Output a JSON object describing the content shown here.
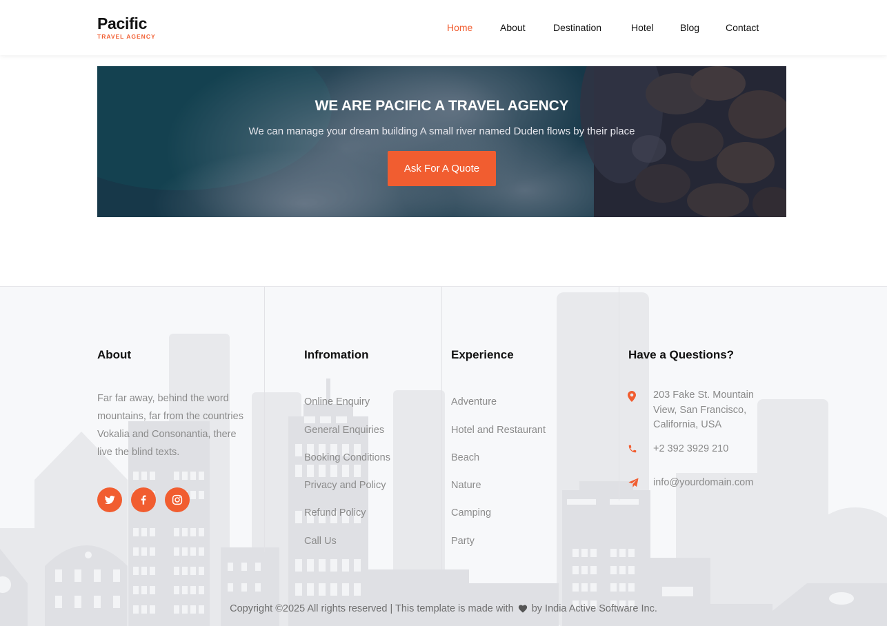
{
  "header": {
    "logo_name": "Pacific",
    "logo_tagline": "TRAVEL AGENCY",
    "nav": [
      {
        "label": "Home",
        "active": true
      },
      {
        "label": "About",
        "active": false
      },
      {
        "label": "Destination",
        "active": false
      },
      {
        "label": "Hotel",
        "active": false
      },
      {
        "label": "Blog",
        "active": false
      },
      {
        "label": "Contact",
        "active": false
      }
    ]
  },
  "hero": {
    "title": "WE ARE PACIFIC A TRAVEL AGENCY",
    "subtitle": "We can manage your dream building A small river named Duden flows by their place",
    "button_label": "Ask For A Quote"
  },
  "footer": {
    "about": {
      "title": "About",
      "text": "Far far away, behind the word mountains, far from the countries Vokalia and Consonantia, there live the blind texts.",
      "social": [
        "twitter-icon",
        "facebook-icon",
        "instagram-icon"
      ]
    },
    "information": {
      "title": "Infromation",
      "links": [
        "Online Enquiry",
        "General Enquiries",
        "Booking Conditions",
        "Privacy and Policy",
        "Refund Policy",
        "Call Us"
      ]
    },
    "experience": {
      "title": "Experience",
      "links": [
        "Adventure",
        "Hotel and Restaurant",
        "Beach",
        "Nature",
        "Camping",
        "Party"
      ]
    },
    "contact": {
      "title": "Have a Questions?",
      "address": "203 Fake St. Mountain View, San Francisco, California, USA",
      "phone": "+2 392 3929 210",
      "email": "info@yourdomain.com"
    },
    "copyright_before": "Copyright ©2025 All rights reserved | This template is made with",
    "copyright_after": "by India Active Software Inc."
  },
  "colors": {
    "accent": "#f15d30",
    "footer_bg": "#f7f8fa",
    "text_muted": "#8b8b8b"
  }
}
